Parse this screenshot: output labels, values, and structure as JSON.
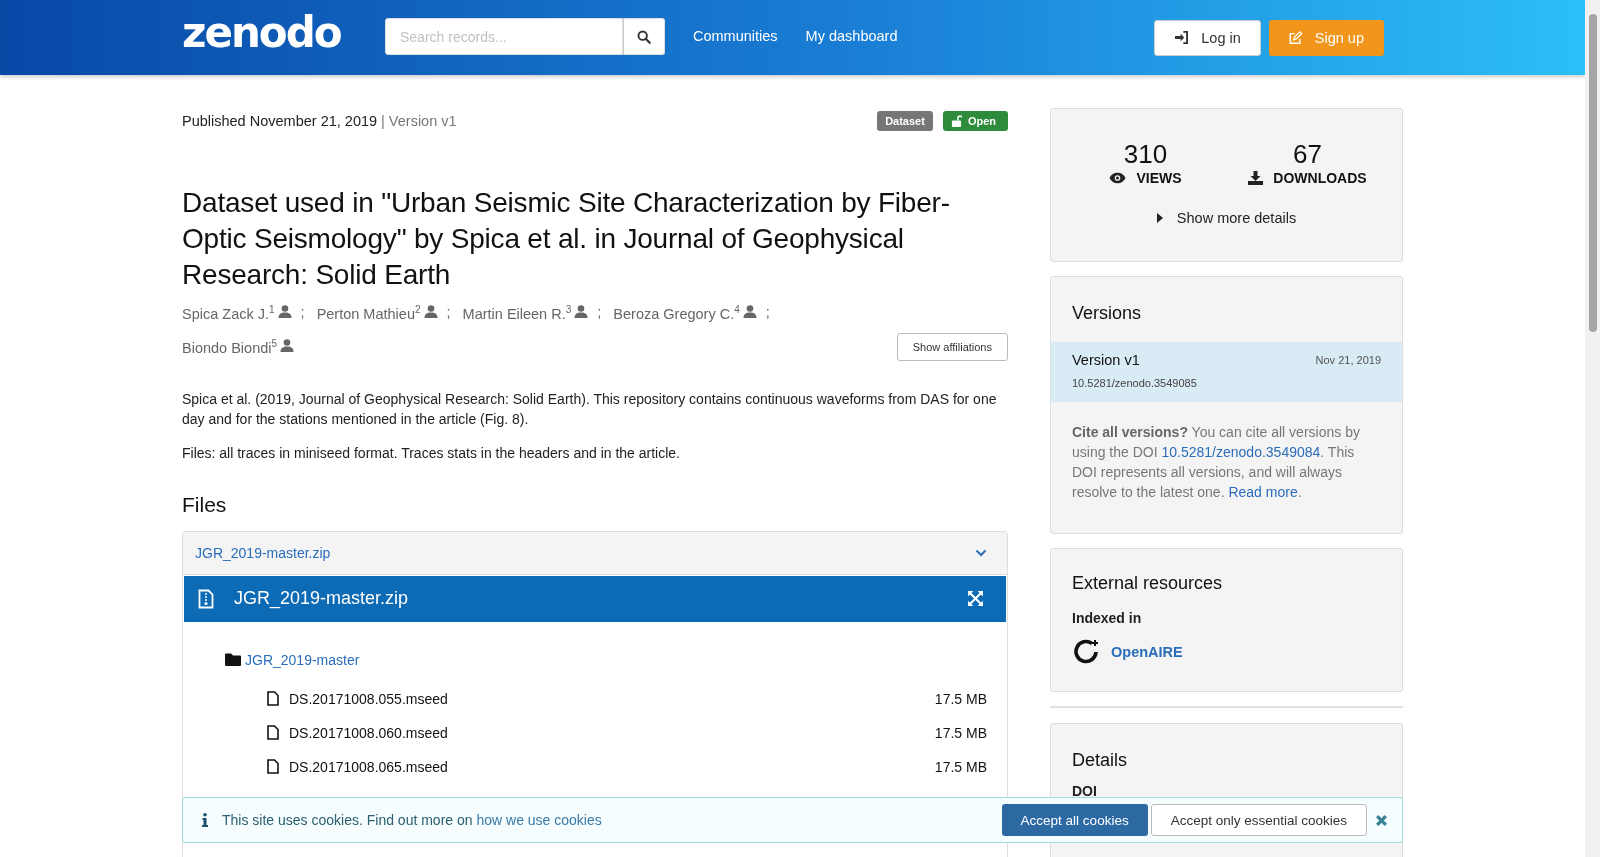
{
  "header": {
    "logo": "zenodo",
    "search": {
      "placeholder": "Search records..."
    },
    "nav": [
      "Communities",
      "My dashboard"
    ],
    "login": "Log in",
    "signup": "Sign up"
  },
  "record": {
    "published": "Published November 21, 2019",
    "version": "| Version v1",
    "badges": [
      {
        "label": "Dataset",
        "kind": "type"
      },
      {
        "label": "Open",
        "kind": "access"
      }
    ],
    "title": "Dataset used in \"Urban Seismic Site Characterization by Fiber-Optic Seismology\" by Spica et al. in Journal of Geophysical Research: Solid Earth",
    "creators": [
      {
        "name": "Spica Zack J.",
        "sup": "1",
        "separator": ";"
      },
      {
        "name": "Perton Mathieu",
        "sup": "2",
        "separator": ";"
      },
      {
        "name": "Martin Eileen R.",
        "sup": "3",
        "separator": ";"
      },
      {
        "name": "Beroza Gregory C.",
        "sup": "4",
        "separator": ";"
      },
      {
        "name": "Biondo Biondi",
        "sup": "5"
      }
    ],
    "show_affiliations": "Show affiliations",
    "description": [
      "Spica et al. (2019, Journal of Geophysical Research: Solid Earth). This repository contains continuous waveforms from DAS for one day and for the stations mentioned in the article (Fig. 8).",
      "Files: all traces in miniseed format. Traces stats in the headers and in the article."
    ],
    "files": {
      "heading": "Files",
      "archive_link": "JGR_2019-master.zip",
      "preview_title": "JGR_2019-master.zip",
      "folder": "JGR_2019-master",
      "items": [
        {
          "name": "DS.20171008.055.mseed",
          "size": "17.5 MB"
        },
        {
          "name": "DS.20171008.060.mseed",
          "size": "17.5 MB"
        },
        {
          "name": "DS.20171008.065.mseed",
          "size": "17.5 MB"
        }
      ]
    }
  },
  "sidebar": {
    "stats": [
      {
        "value": "310",
        "label": "VIEWS",
        "kind": "views"
      },
      {
        "value": "67",
        "label": "DOWNLOADS",
        "kind": "downloads"
      }
    ],
    "show_more": "Show more details",
    "versions": {
      "heading": "Versions",
      "items": [
        {
          "title": "Version v1",
          "date": "Nov 21, 2019",
          "doi": "10.5281/zenodo.3549085",
          "selected": true
        }
      ],
      "cite": {
        "lead": "Cite all versions?",
        "before": " You can cite all versions by using the DOI ",
        "doi": "10.5281/zenodo.3549084",
        "after": ". This DOI represents all versions, and will always resolve to the latest one. ",
        "link": "Read more",
        "end": "."
      }
    },
    "external": {
      "heading": "External resources",
      "label": "Indexed in",
      "items": [
        "OpenAIRE"
      ]
    },
    "details": {
      "heading": "Details",
      "fields": [
        "DOI"
      ]
    }
  },
  "cookie_banner": {
    "text": "This site uses cookies. Find out more on ",
    "link": "how we use cookies",
    "accept_all": "Accept all cookies",
    "accept_essential": "Accept only essential cookies"
  }
}
